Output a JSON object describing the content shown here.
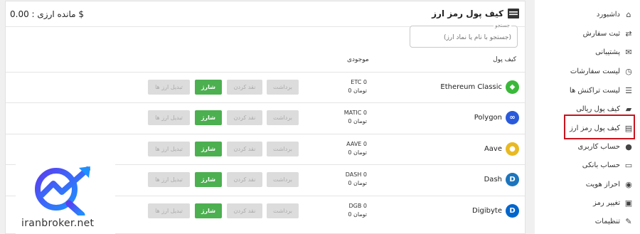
{
  "sidebar": {
    "items": [
      {
        "label": "داشبورد",
        "icon": "home-icon",
        "glyph": "⌂"
      },
      {
        "label": "ثبت سفارش",
        "icon": "order-icon",
        "glyph": "⇄"
      },
      {
        "label": "پشتیبانی",
        "icon": "support-icon",
        "glyph": "✉"
      },
      {
        "label": "لیست سفارشات",
        "icon": "history-icon",
        "glyph": "◷"
      },
      {
        "label": "لیست تراکنش ها",
        "icon": "list-icon",
        "glyph": "☰"
      },
      {
        "label": "کیف پول ریالی",
        "icon": "wallet-icon",
        "glyph": "▰"
      },
      {
        "label": "کیف پول رمز ارز",
        "icon": "crypto-wallet-icon",
        "glyph": "▤"
      },
      {
        "label": "حساب کاربری",
        "icon": "user-icon",
        "glyph": "●"
      },
      {
        "label": "حساب بانکی",
        "icon": "card-icon",
        "glyph": "▭"
      },
      {
        "label": "احراز هویت",
        "icon": "id-icon",
        "glyph": "◉"
      },
      {
        "label": "تغییر رمز",
        "icon": "lock-icon",
        "glyph": "▣"
      },
      {
        "label": "تنظیمات",
        "icon": "wrench-icon",
        "glyph": "✎"
      }
    ]
  },
  "header": {
    "title": "کیف پول رمز ارز",
    "balance": "مانده ارزی : 0.00 $"
  },
  "search": {
    "label": "جستجو",
    "placeholder": "(جستجو با نام یا نماد ارز)"
  },
  "table": {
    "col_wallet": "کیف پول",
    "col_balance": "موجودی",
    "buttons": {
      "charge": "شارژ",
      "cash": "نقد کردن",
      "withdraw": "برداشت",
      "convert": "تبدیل ارز ها"
    },
    "rows": [
      {
        "name": "Ethereum Classic",
        "amount": "ETC 0",
        "toman": "0 تومان",
        "icon": "ethereum-classic-icon",
        "color": "#3ab83a",
        "glyph": "◆"
      },
      {
        "name": "Polygon",
        "amount": "MATIC 0",
        "toman": "0 تومان",
        "icon": "polygon-icon",
        "color": "#2a5ada",
        "glyph": "∞"
      },
      {
        "name": "Aave",
        "amount": "AAVE 0",
        "toman": "0 تومان",
        "icon": "aave-icon",
        "color": "#e8b923",
        "glyph": "●"
      },
      {
        "name": "Dash",
        "amount": "DASH 0",
        "toman": "0 تومان",
        "icon": "dash-icon",
        "color": "#1c75bc",
        "glyph": "D"
      },
      {
        "name": "Digibyte",
        "amount": "DGB 0",
        "toman": "0 تومان",
        "icon": "digibyte-icon",
        "color": "#0066cc",
        "glyph": "D"
      }
    ]
  },
  "watermark": {
    "text": "iranbroker.net"
  }
}
